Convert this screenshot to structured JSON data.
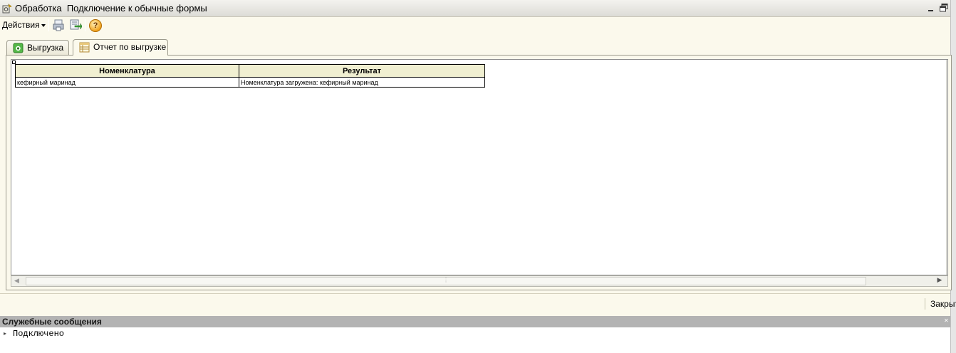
{
  "window": {
    "title_prefix": "Обработка",
    "title": "Подключение к обычные формы",
    "icons": {
      "app": "processing-gear-icon",
      "minimize": "minimize-icon",
      "restore": "restore-icon"
    }
  },
  "toolbar": {
    "actions_label": "Действия",
    "icons": [
      "print-icon",
      "export-icon",
      "help-icon"
    ],
    "help_glyph": "?"
  },
  "tabs": [
    {
      "label": "Выгрузка",
      "icon": "export-green-icon",
      "active": false
    },
    {
      "label": "Отчет по выгрузке",
      "icon": "report-grid-icon",
      "active": true
    }
  ],
  "report": {
    "columns": [
      "Номенклатура",
      "Результат"
    ],
    "rows": [
      [
        "кефирный маринад",
        "Номенклатура загружена: кефирный маринад"
      ]
    ],
    "header_color": "#f0efd1"
  },
  "command_bar": {
    "close_label": "Закрыть"
  },
  "messages": {
    "title": "Служебные сообщения",
    "items": [
      "Подключено"
    ]
  },
  "colors": {
    "background": "#fbf9ec",
    "messages_header": "#b3b3b3"
  }
}
